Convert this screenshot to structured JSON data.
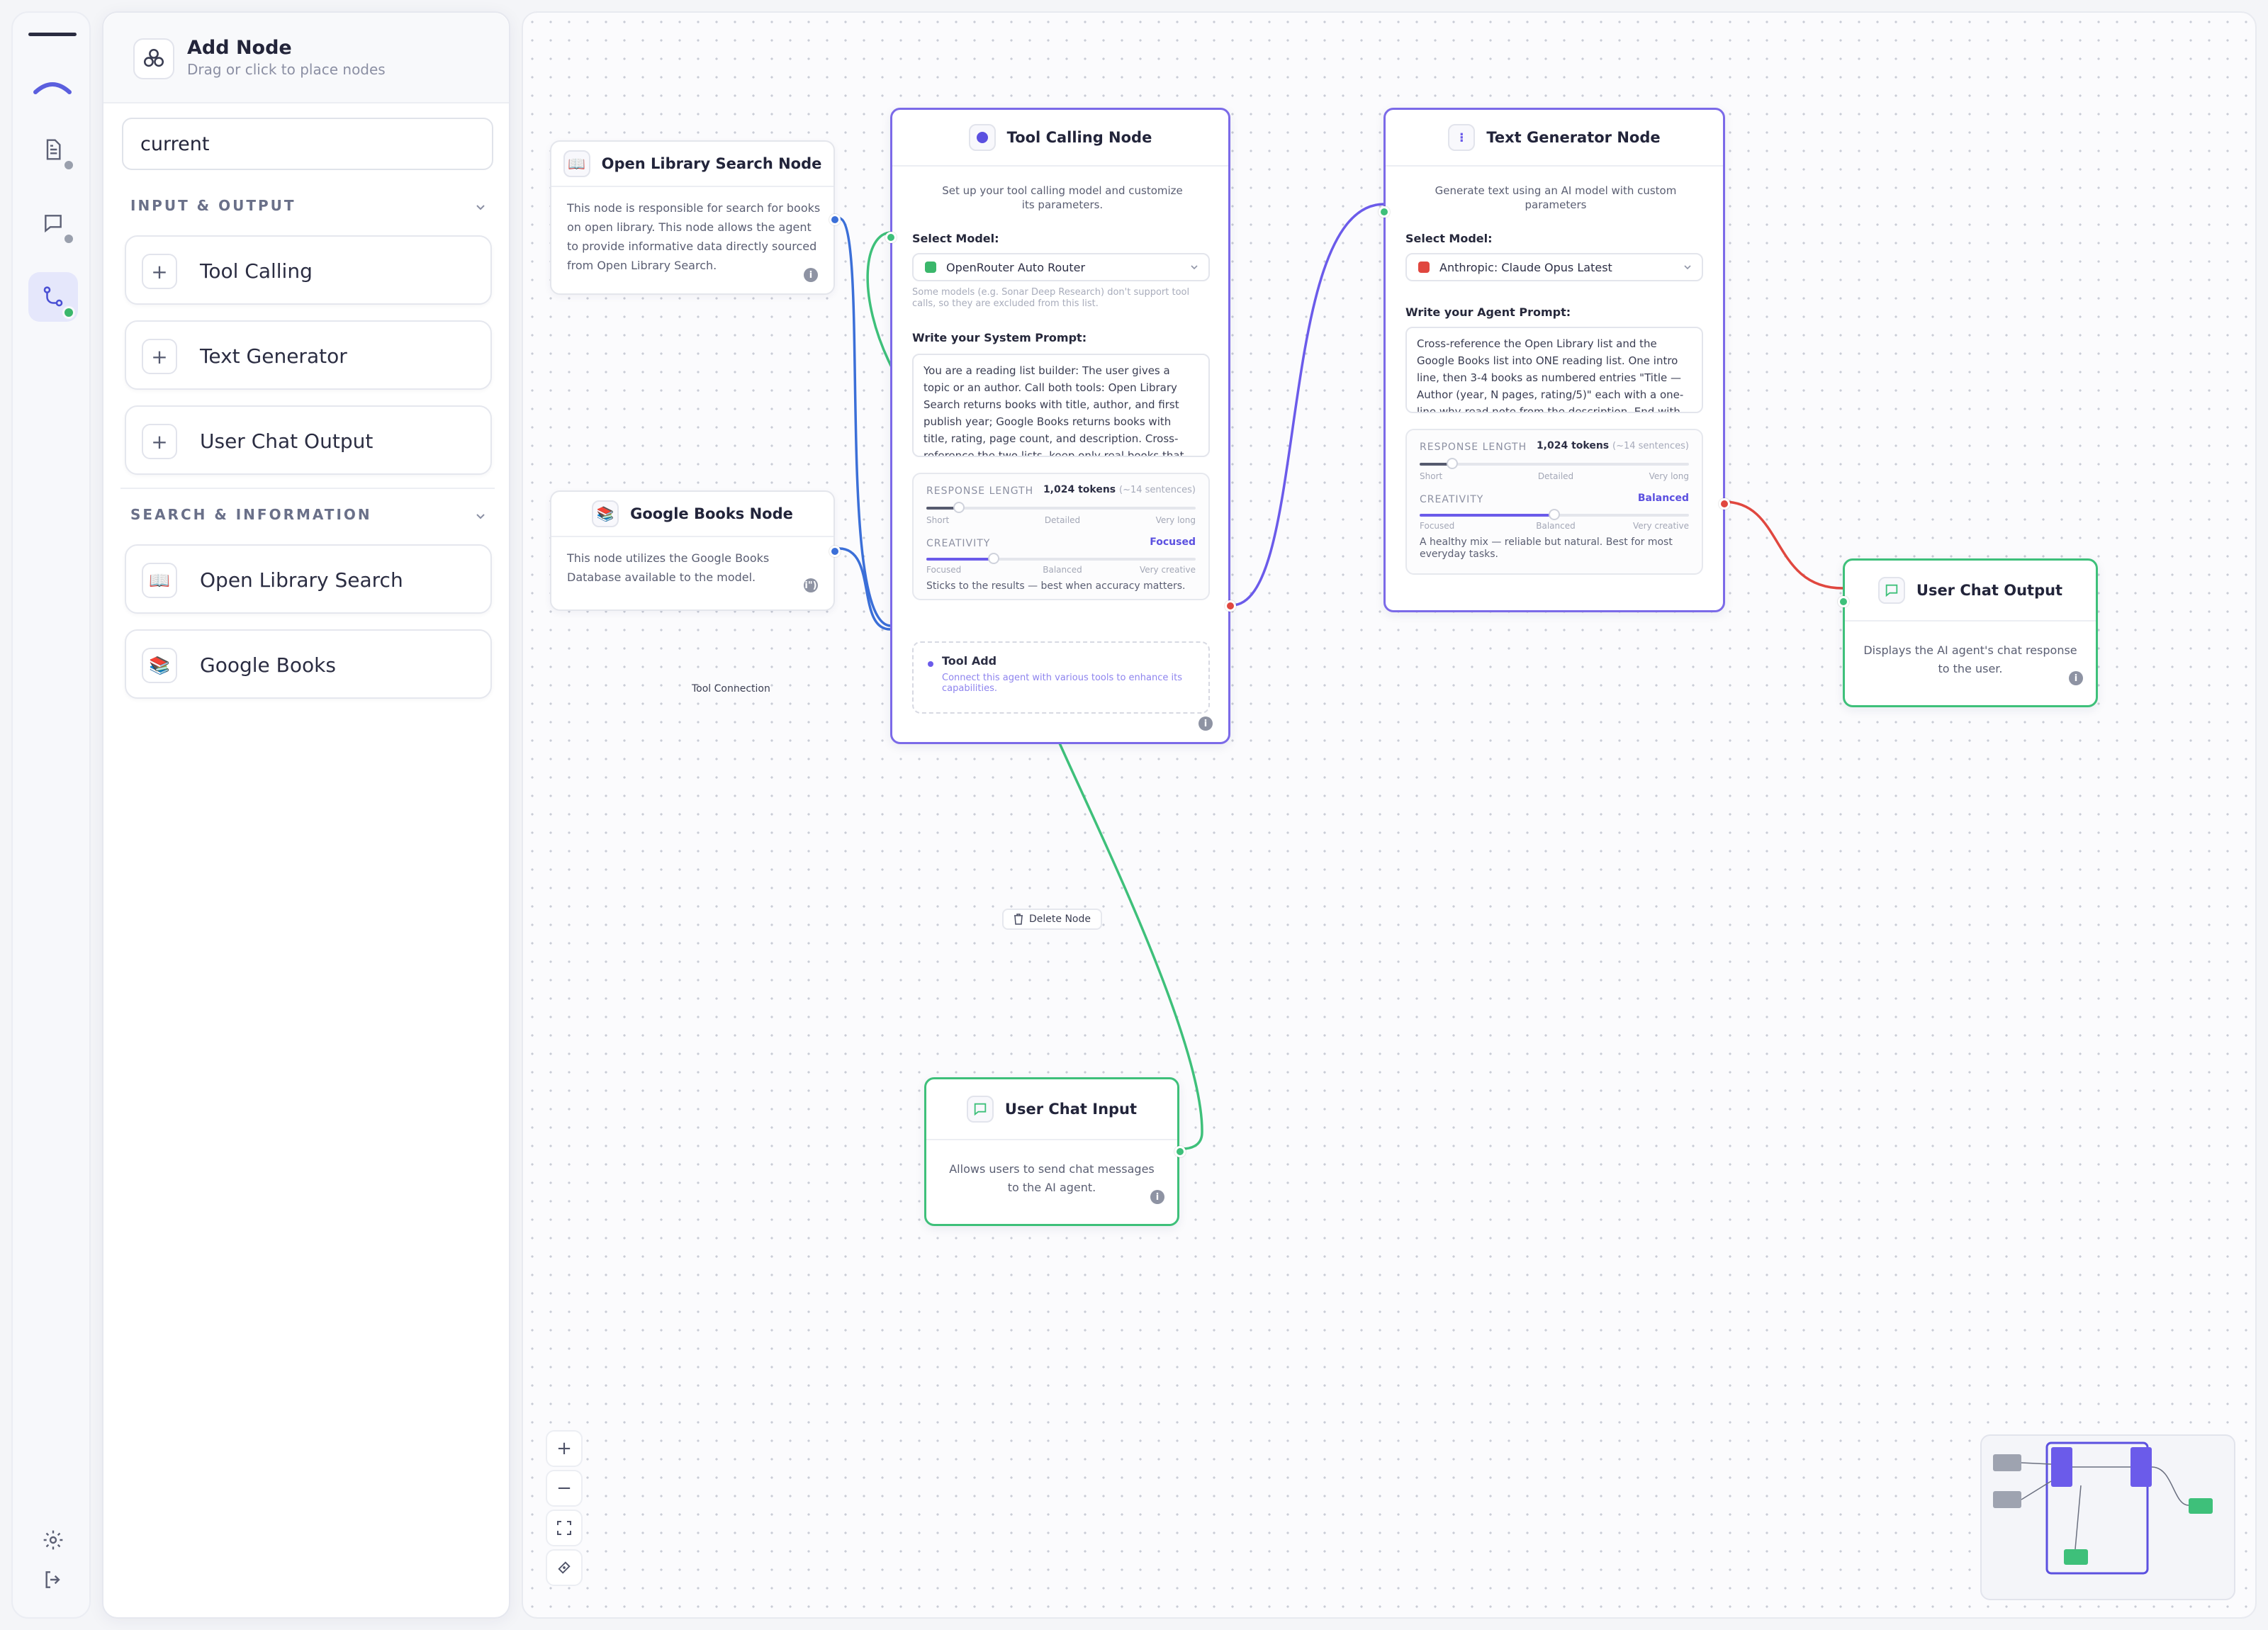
{
  "panel": {
    "title": "Add Node",
    "subtitle": "Drag or click to place nodes",
    "search_value": "current",
    "sections": [
      {
        "title": "INPUT & OUTPUT",
        "items": [
          {
            "label": "Tool Calling",
            "icon": "plus-icon"
          },
          {
            "label": "Text Generator",
            "icon": "plus-icon"
          },
          {
            "label": "User Chat Output",
            "icon": "plus-icon"
          }
        ]
      },
      {
        "title": "SEARCH & INFORMATION",
        "items": [
          {
            "label": "Open Library Search",
            "icon": "open-book-icon"
          },
          {
            "label": "Google Books",
            "icon": "books-stack-icon"
          }
        ]
      }
    ]
  },
  "nodes": {
    "open_library": {
      "title": "Open Library Search Node",
      "desc": "This node is responsible for search for books on open library. This node allows the agent to provide informative data directly sourced from Open Library Search."
    },
    "google_books": {
      "title": "Google Books Node",
      "desc": "This node utilizes the Google Books Database available to the model."
    },
    "tool_calling": {
      "title": "Tool Calling Node",
      "desc": "Set up your tool calling model and customize its parameters.",
      "model_label": "Select Model:",
      "model": "OpenRouter Auto Router",
      "model_note": "Some models (e.g. Sonar Deep Research) don't support tool calls, so they are excluded from this list.",
      "prompt_label": "Write your System Prompt:",
      "prompt": "You are a reading list builder: The user gives a topic or an author. Call both tools: Open Library Search returns books with title, author, and first publish year; Google Books returns books with title, rating, page count, and description. Cross-reference the two lists, keep only real books that appear in the results, and pass both lists to",
      "length_label": "RESPONSE LENGTH",
      "length_value": "1,024 tokens",
      "length_approx": "(~14 sentences)",
      "length_ticks": [
        "Short",
        "Detailed",
        "Very long"
      ],
      "length_level": 0.12,
      "creativity_label": "CREATIVITY",
      "creativity_value": "Focused",
      "creativity_ticks": [
        "Focused",
        "Balanced",
        "Very creative"
      ],
      "creativity_level": 0.25,
      "creativity_desc": "Sticks to the results — best when accuracy matters.",
      "tool_add_title": "Tool Add",
      "tool_add_desc": "Connect this agent with various tools to enhance its capabilities."
    },
    "text_generator": {
      "title": "Text Generator Node",
      "desc": "Generate text using an AI model with custom parameters",
      "model_label": "Select Model:",
      "model": "Anthropic: Claude Opus Latest",
      "prompt_label": "Write your Agent Prompt:",
      "prompt": "Cross-reference the Open Library list and the Google Books list into ONE reading list. One intro line, then 3-4 books as numbered entries \"Title — Author (year, N pages, rating/5)\" each with a one-line why-read note from the description. End with \"Read first\" naming the",
      "length_label": "RESPONSE LENGTH",
      "length_value": "1,024 tokens",
      "length_approx": "(~14 sentences)",
      "length_ticks": [
        "Short",
        "Detailed",
        "Very long"
      ],
      "length_level": 0.12,
      "creativity_label": "CREATIVITY",
      "creativity_value": "Balanced",
      "creativity_ticks": [
        "Focused",
        "Balanced",
        "Very creative"
      ],
      "creativity_level": 0.5,
      "creativity_desc": "A healthy mix — reliable but natural. Best for most everyday tasks."
    },
    "chat_output": {
      "title": "User Chat Output",
      "desc": "Displays the AI agent's chat response to the user."
    },
    "chat_input": {
      "title": "User Chat Input",
      "desc": "Allows users to send chat messages to the AI agent."
    }
  },
  "canvas": {
    "tool_connection_label": "Tool Connection",
    "delete_node_label": "Delete Node",
    "controls": [
      "zoom-in",
      "zoom-out",
      "fit-view",
      "lock"
    ]
  },
  "colors": {
    "accent": "#6b5bea",
    "tool_border": "#7b6ae8",
    "green": "#3ec07a",
    "blue": "#3b6fd8",
    "red": "#e0473f"
  }
}
